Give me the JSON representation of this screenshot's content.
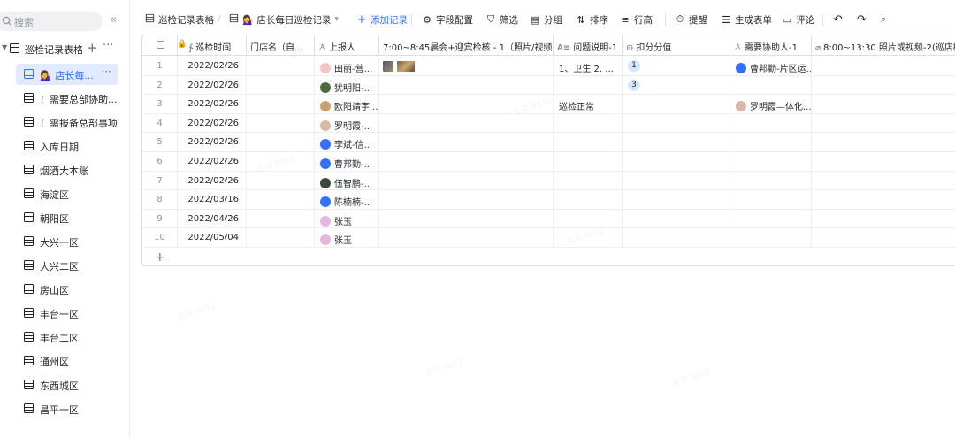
{
  "sidebar": {
    "search_placeholder": "搜索",
    "collapse": "«",
    "base_title": "巡检记录表格",
    "add": "+",
    "more": "···",
    "items": [
      {
        "label": "💁‍♀️ 店长每...",
        "active": true
      },
      {
        "label": "！需要总部协助..."
      },
      {
        "label": "！需报备总部事项"
      },
      {
        "label": "入库日期"
      },
      {
        "label": "烟酒大本账"
      },
      {
        "label": "海淀区"
      },
      {
        "label": "朝阳区"
      },
      {
        "label": "大兴一区"
      },
      {
        "label": "大兴二区"
      },
      {
        "label": "房山区"
      },
      {
        "label": "丰台一区"
      },
      {
        "label": "丰台二区"
      },
      {
        "label": "通州区"
      },
      {
        "label": "东西城区"
      },
      {
        "label": "昌平一区"
      }
    ]
  },
  "toolbar": {
    "table_name": "巡检记录表格",
    "view_name": "💁‍♀️ 店长每日巡检记录",
    "view_caret": "▾",
    "add_record": "添加记录",
    "field_config": "字段配置",
    "filter": "筛选",
    "group": "分组",
    "sort": "排序",
    "row_height": "行高",
    "remind": "提醒",
    "form": "生成表单",
    "comment": "评论"
  },
  "columns": [
    {
      "label": "巡检时间",
      "icon": "∱"
    },
    {
      "label": "门店名（自...",
      "icon": ""
    },
    {
      "label": "上报人",
      "icon": "♙"
    },
    {
      "label": "7:00~8:45晨会+迎宾检核 - 1（照片/视频）",
      "icon": ""
    },
    {
      "label": "问题说明-1",
      "icon": "A≡"
    },
    {
      "label": "扣分分值",
      "icon": "⊝"
    },
    {
      "label": "需要协助人-1",
      "icon": "♙"
    },
    {
      "label": "8:00~13:30 照片或视频-2(巡店检核",
      "icon": "⌀"
    }
  ],
  "rows": [
    {
      "num": "1",
      "date": "2022/02/26",
      "reporter": "田丽-营...",
      "avatar": "#f3c6c6",
      "photos": true,
      "issue": "1、卫生 2. ...",
      "score": "1",
      "helper": "曹邦勤-片区运...",
      "helper_avatar": "#3370ff"
    },
    {
      "num": "2",
      "date": "2022/02/26",
      "reporter": "犹明阳-...",
      "avatar": "#4a6b3a",
      "photos": false,
      "issue": "",
      "score": "3",
      "helper": "",
      "helper_avatar": ""
    },
    {
      "num": "3",
      "date": "2022/02/26",
      "reporter": "欧阳靖宇...",
      "avatar": "#c9a36b",
      "photos": false,
      "issue": "巡检正常",
      "score": "",
      "helper": "罗明霞—体化...",
      "helper_avatar": "#d9b8a8"
    },
    {
      "num": "4",
      "date": "2022/02/26",
      "reporter": "罗明霞-...",
      "avatar": "#d9b8a8",
      "photos": false,
      "issue": "",
      "score": "",
      "helper": "",
      "helper_avatar": ""
    },
    {
      "num": "5",
      "date": "2022/02/26",
      "reporter": "李斌-信...",
      "avatar": "#3370ff",
      "photos": false,
      "issue": "",
      "score": "",
      "helper": "",
      "helper_avatar": ""
    },
    {
      "num": "6",
      "date": "2022/02/26",
      "reporter": "曹邦勤-...",
      "avatar": "#3370ff",
      "photos": false,
      "issue": "",
      "score": "",
      "helper": "",
      "helper_avatar": ""
    },
    {
      "num": "7",
      "date": "2022/02/26",
      "reporter": "伍智鹏-...",
      "avatar": "#3a4a3a",
      "photos": false,
      "issue": "",
      "score": "",
      "helper": "",
      "helper_avatar": ""
    },
    {
      "num": "8",
      "date": "2022/03/16",
      "reporter": "陈楠楠-...",
      "avatar": "#3370ff",
      "photos": false,
      "issue": "",
      "score": "",
      "helper": "",
      "helper_avatar": ""
    },
    {
      "num": "9",
      "date": "2022/04/26",
      "reporter": "张玉",
      "avatar": "#e7b6e0",
      "photos": false,
      "issue": "",
      "score": "",
      "helper": "",
      "helper_avatar": ""
    },
    {
      "num": "10",
      "date": "2022/05/04",
      "reporter": "张玉",
      "avatar": "#e7b6e0",
      "photos": false,
      "issue": "",
      "score": "",
      "helper": "",
      "helper_avatar": ""
    }
  ],
  "add_row": "+"
}
